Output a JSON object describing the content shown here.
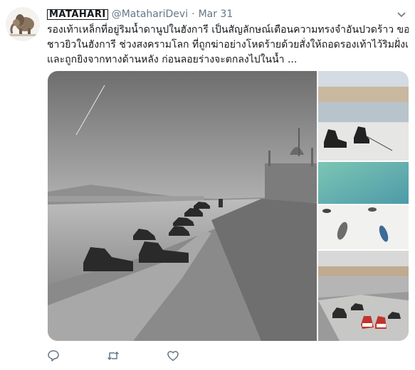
{
  "tweet": {
    "display_name": "MATAHARI",
    "handle": "@MatahariDevi",
    "separator": "·",
    "date": "Mar 31",
    "text_lines": [
      "รองเท้าเหล็กที่อยู่ริมน้ำดานูปในฮังการี เป็นสัญลักษณ์เตือนความทรงจำอันปวดร้าว ของ",
      "ชาวยิวในฮังการี ช่วงสงครามโลก ที่ถูกฆ่าอย่างโหดร้ายด้วยสั่งให้ถอดรองเท้าไว้ริมฝั่งแม่น้ำ",
      "และถูกยิงจากทางด้านหลัง ก่อนลอยร่างจะตกลงไปในน้ำ ..."
    ]
  },
  "colors": {
    "icon_gray": "#657786",
    "text": "#14171a",
    "teal_water": "#5fa8a0",
    "shoe_red": "#c0342c"
  },
  "icons": {
    "reply": "reply-icon",
    "retweet": "retweet-icon",
    "like": "heart-icon",
    "menu": "chevron-down-icon"
  }
}
